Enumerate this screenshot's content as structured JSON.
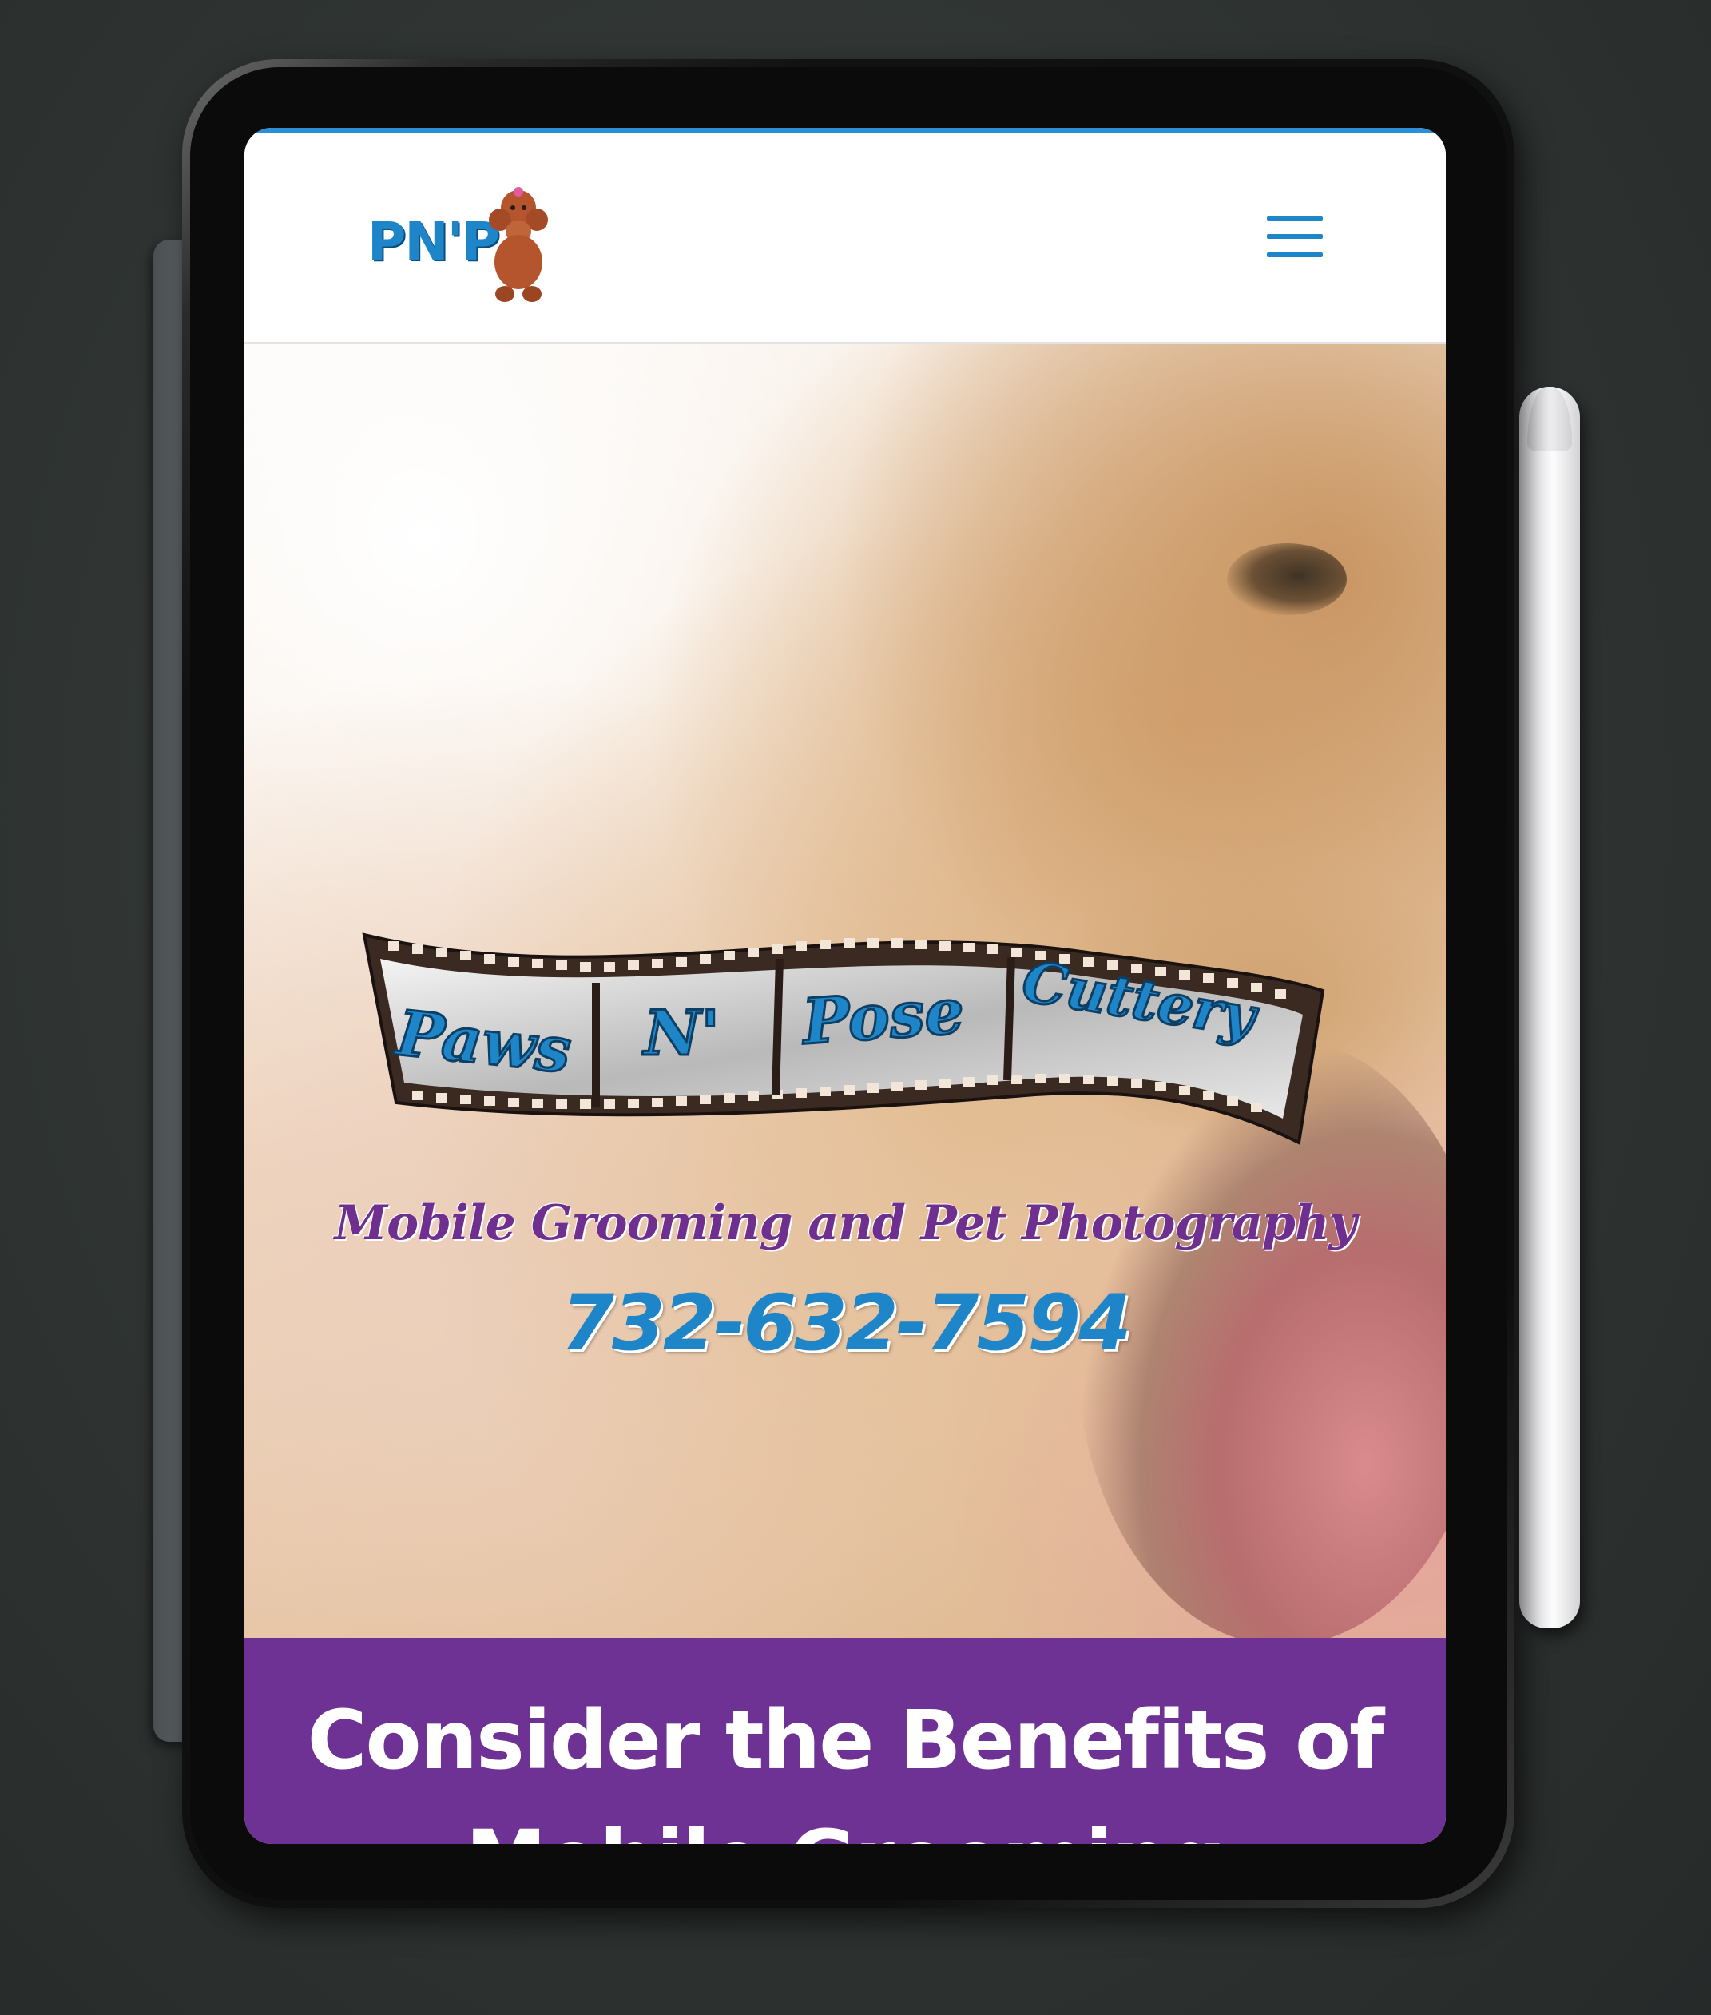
{
  "header": {
    "logo_text": "PN'P",
    "menu_icon": "hamburger-menu-icon"
  },
  "hero": {
    "logo_words": [
      "Paws",
      "N'",
      "Pose",
      "Cuttery"
    ],
    "tagline": "Mobile Grooming and Pet Photography",
    "phone": "732-632-7594"
  },
  "benefits": {
    "heading": "Consider the Benefits of Mobile Grooming"
  },
  "colors": {
    "accent_blue": "#1e86c8",
    "brand_purple": "#6e3294",
    "tagline_purple": "#6e2f8e"
  }
}
